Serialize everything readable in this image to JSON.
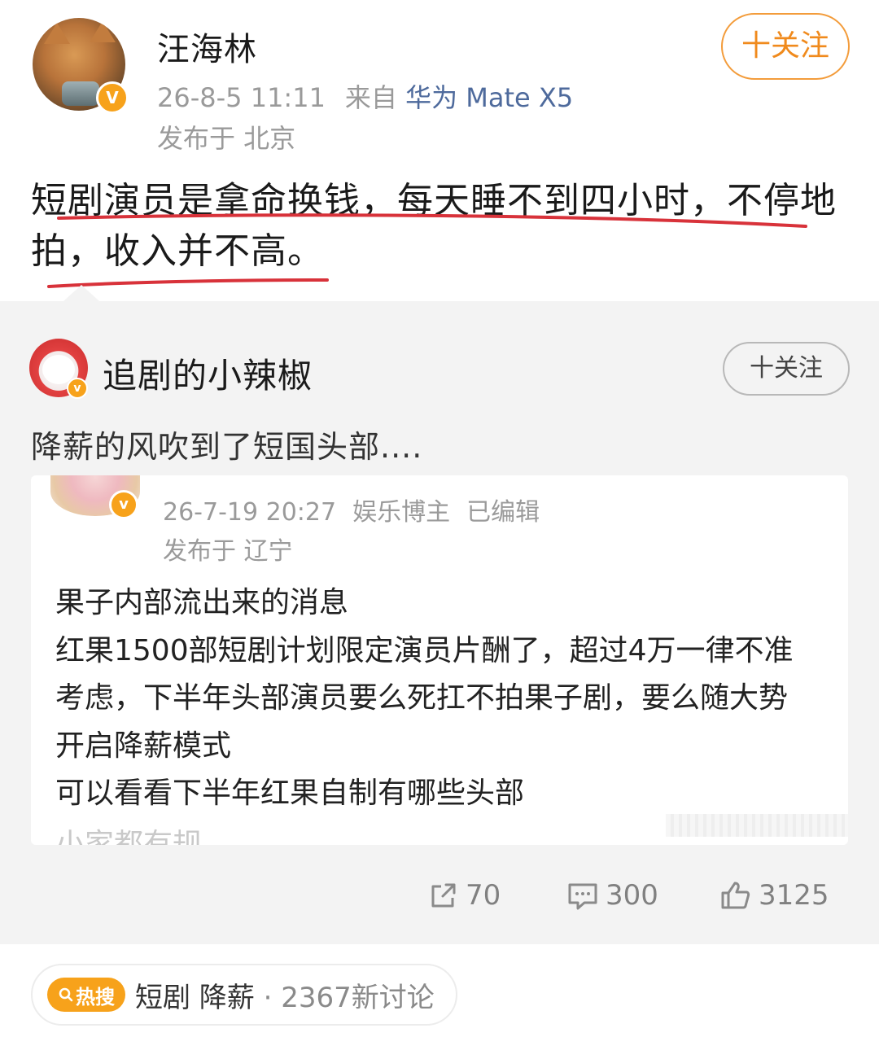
{
  "post": {
    "author": "汪海林",
    "timestamp": "26-8-5 11:11",
    "source_prefix": "来自",
    "device": "华为 Mate X5",
    "location": "发布于 北京",
    "follow_label": "十关注",
    "text_line1": "短剧演员是拿命换钱，每天睡不到四小时，不停地",
    "text_line2": "拍，收入并不高。",
    "verified_badge": "V",
    "underline_color": "#d8323a"
  },
  "repost": {
    "author": "追剧的小辣椒",
    "follow_label": "十关注",
    "verified_badge": "v",
    "text": "降薪的风吹到了短国头部....",
    "embedded": {
      "timestamp": "26-7-19 20:27",
      "author_type": "娱乐博主",
      "edited": "已编辑",
      "location": "发布于 辽宁",
      "verified_badge": "v",
      "lines": [
        "果子内部流出来的消息",
        "红果1500部短剧计划限定演员片酬了，超过4万一律不准",
        "考虑，下半年头部演员要么死扛不拍果子剧，要么随大势",
        "开启降薪模式",
        "可以看看下半年红果自制有哪些头部"
      ],
      "truncated_line": "小家都有规"
    },
    "actions": {
      "share_icon": "share-icon",
      "share_count": "70",
      "comment_icon": "comment-icon",
      "comment_count": "300",
      "like_icon": "thumbs-up-icon",
      "like_count": "3125"
    }
  },
  "hot_search": {
    "badge_icon": "search-icon",
    "badge_label": "热搜",
    "topic": "短剧 降薪",
    "separator": " · ",
    "discussion": "2367新讨论",
    "badge_color": "#f7a21b"
  }
}
